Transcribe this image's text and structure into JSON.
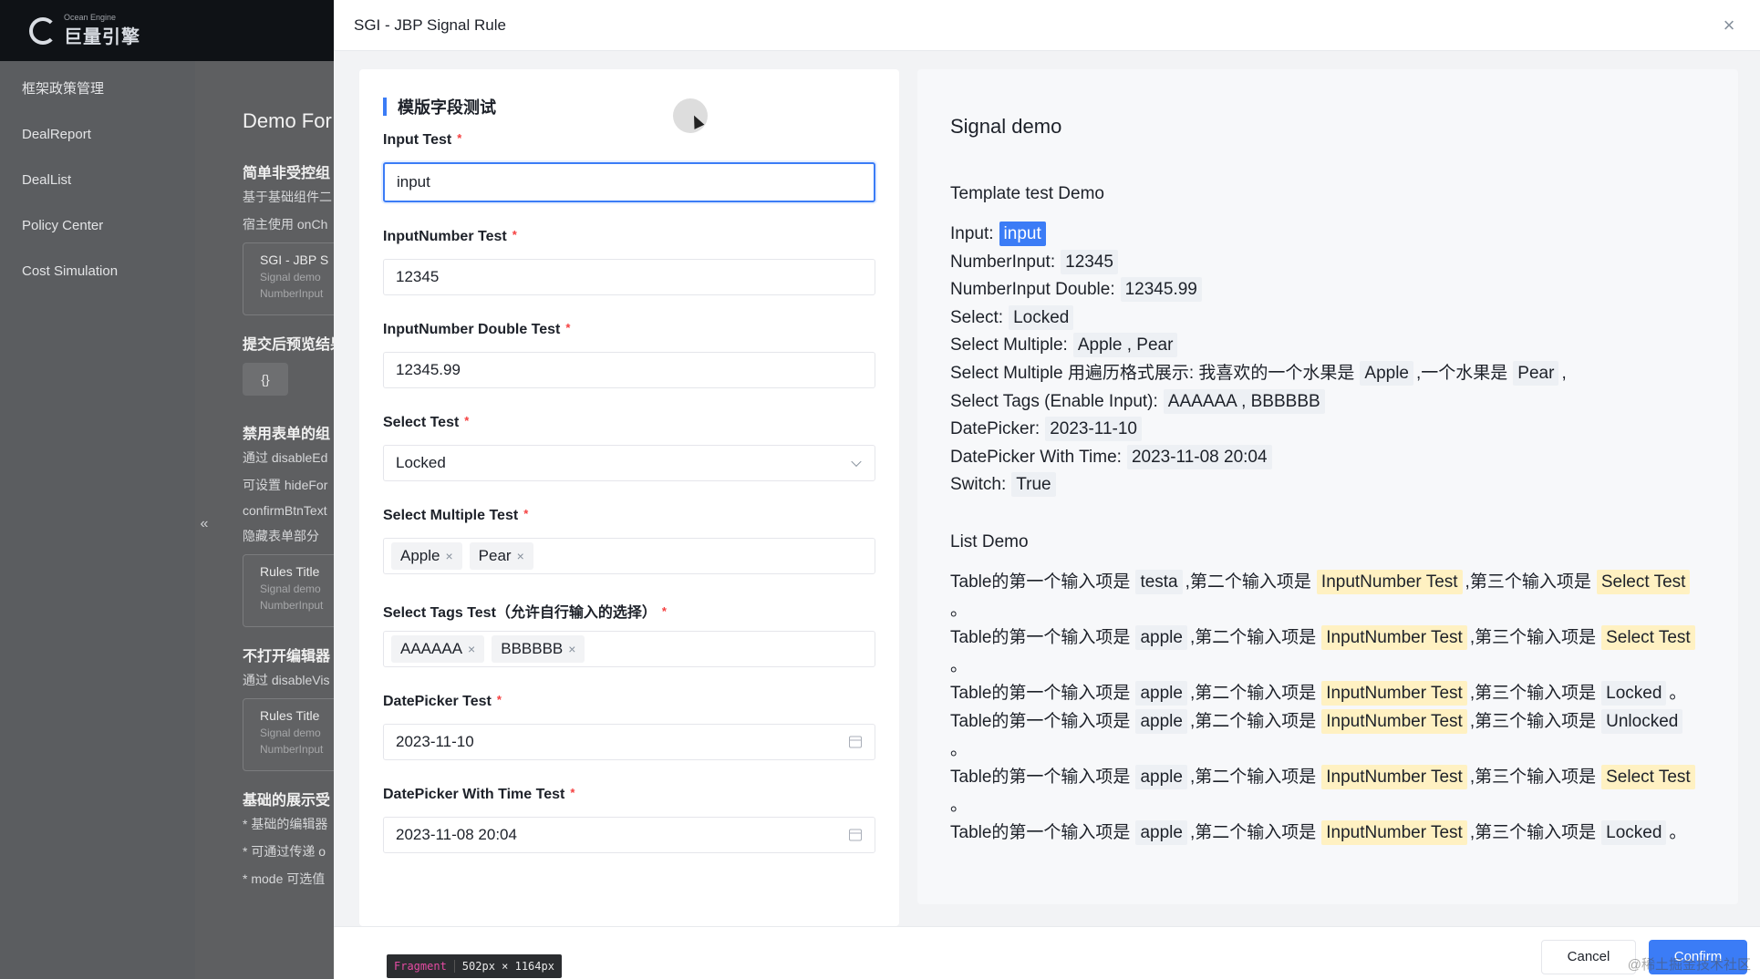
{
  "brand": {
    "small": "Ocean Engine",
    "big": "巨量引擎"
  },
  "sidebar": {
    "items": [
      "框架政策管理",
      "DealReport",
      "DealList",
      "Policy Center",
      "Cost Simulation"
    ]
  },
  "background_page": {
    "title": "Demo For",
    "collapse_icon": "«",
    "sections": [
      {
        "heading": "简单非受控组",
        "lines": [
          "基于基础组件二",
          "宿主使用 onCh"
        ]
      },
      {
        "card": {
          "title": "SGI - JBP S",
          "sub1": "Signal demo",
          "sub2": "NumberInput"
        }
      },
      {
        "heading": "提交后预览结果",
        "chip": "{}"
      },
      {
        "heading": "禁用表单的组",
        "lines": [
          "通过 disableEd",
          "可设置 hideFor",
          "confirmBtnText",
          "隐藏表单部分"
        ]
      },
      {
        "card": {
          "title": "Rules Title",
          "sub1": "Signal demo",
          "sub2": "NumberInput"
        }
      },
      {
        "heading": "不打开编辑器",
        "lines": [
          "通过 disableVis"
        ]
      },
      {
        "card": {
          "title": "Rules Title",
          "sub1": "Signal demo",
          "sub2": "NumberInput"
        }
      },
      {
        "heading": "基础的展示受",
        "lines": [
          "* 基础的编辑器",
          "* 可通过传递 o",
          "* mode 可选值"
        ]
      }
    ]
  },
  "drawer": {
    "title": "SGI - JBP Signal Rule",
    "close_icon": "×"
  },
  "form": {
    "section_title": "模版字段测试",
    "fields": {
      "input": {
        "label": "Input Test",
        "value": "input"
      },
      "input_number": {
        "label": "InputNumber Test",
        "value": "12345"
      },
      "input_number_double": {
        "label": "InputNumber Double Test",
        "value": "12345.99"
      },
      "select": {
        "label": "Select Test",
        "value": "Locked"
      },
      "select_multiple": {
        "label": "Select Multiple Test",
        "tags": [
          "Apple",
          "Pear"
        ]
      },
      "select_tags": {
        "label": "Select Tags Test（允许自行输入的选择）",
        "tags": [
          "AAAAAA",
          "BBBBBB"
        ]
      },
      "date_picker": {
        "label": "DatePicker Test",
        "value": "2023-11-10"
      },
      "date_time_picker": {
        "label": "DatePicker With Time Test",
        "value": "2023-11-08 20:04"
      }
    },
    "required_mark": "*",
    "tag_close": "×"
  },
  "preview": {
    "title": "Signal demo",
    "template_heading": "Template test Demo",
    "labels": {
      "input": "Input:",
      "number": "NumberInput:",
      "number_double": "NumberInput Double:",
      "select": "Select:",
      "select_multiple": "Select Multiple:",
      "select_multiple_iter_prefix": "Select Multiple 用遍历格式展示: 我喜欢的一个水果是",
      "select_multiple_iter_mid": ",一个水果是",
      "select_multiple_iter_end": ",",
      "select_tags": "Select Tags (Enable Input):",
      "date": "DatePicker:",
      "date_time": "DatePicker With Time:",
      "switch": "Switch:"
    },
    "values": {
      "input": "input",
      "number": "12345",
      "number_double": "12345.99",
      "select": "Locked",
      "select_multiple": "Apple , Pear",
      "fruit1": "Apple",
      "fruit2": "Pear",
      "select_tags": "AAAAAA , BBBBBB",
      "date": "2023-11-10",
      "date_time": "2023-11-08 20:04",
      "switch": "True"
    },
    "list_heading": "List Demo",
    "list_text": {
      "p1": "Table的第一个输入项是",
      "p2": ",第二个输入项是",
      "p3": ",第三个输入项是",
      "end": "。"
    },
    "list_rows": [
      {
        "first": "testa",
        "second": "InputNumber Test",
        "third": "Select Test",
        "third_hl": true
      },
      {
        "first": "apple",
        "second": "InputNumber Test",
        "third": "Select Test",
        "third_hl": true
      },
      {
        "first": "apple",
        "second": "InputNumber Test",
        "third": "Locked",
        "third_hl": false
      },
      {
        "first": "apple",
        "second": "InputNumber Test",
        "third": "Unlocked",
        "third_hl": false
      },
      {
        "first": "apple",
        "second": "InputNumber Test",
        "third": "Select Test",
        "third_hl": true
      },
      {
        "first": "apple",
        "second": "InputNumber Test",
        "third": "Locked",
        "third_hl": false
      }
    ]
  },
  "footer": {
    "cancel": "Cancel",
    "confirm": "Confirm",
    "fragment_name": "Fragment",
    "fragment_size": "502px × 1164px",
    "watermark": "@稀土掘金技术社区"
  },
  "colors": {
    "primary": "#3b7cf6",
    "highlight": "#fff1c2",
    "required": "#f53f3f"
  }
}
